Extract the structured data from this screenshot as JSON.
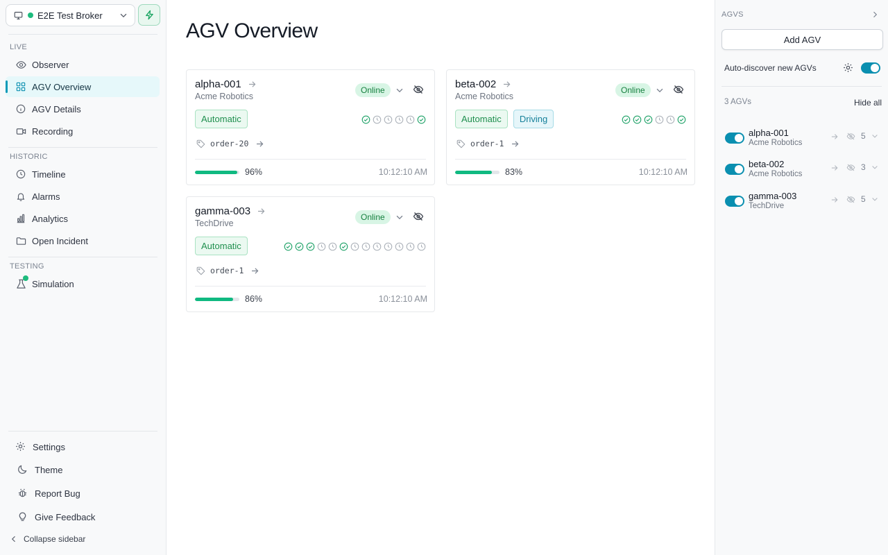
{
  "broker": {
    "name": "E2E Test Broker",
    "status_color": "#1dbb7d"
  },
  "sidebar": {
    "sections": {
      "live": "LIVE",
      "historic": "HISTORIC",
      "testing": "TESTING"
    },
    "live_items": [
      {
        "label": "Observer",
        "icon": "eye-icon"
      },
      {
        "label": "AGV Overview",
        "icon": "grid-icon",
        "active": true
      },
      {
        "label": "AGV Details",
        "icon": "info-icon"
      },
      {
        "label": "Recording",
        "icon": "video-icon"
      }
    ],
    "historic_items": [
      {
        "label": "Timeline",
        "icon": "clock-icon"
      },
      {
        "label": "Alarms",
        "icon": "bell-icon"
      },
      {
        "label": "Analytics",
        "icon": "bar-chart-icon"
      },
      {
        "label": "Open Incident",
        "icon": "folder-icon"
      }
    ],
    "testing_items": [
      {
        "label": "Simulation",
        "icon": "flask-icon"
      }
    ],
    "bottom": {
      "settings": "Settings",
      "theme": "Theme",
      "report_bug": "Report Bug",
      "give_feedback": "Give Feedback",
      "collapse": "Collapse sidebar"
    }
  },
  "main": {
    "title": "AGV Overview",
    "cards": [
      {
        "name": "alpha-001",
        "manufacturer": "Acme Robotics",
        "status": "Online",
        "tags": [
          "Automatic"
        ],
        "steps": [
          "done",
          "pending",
          "pending",
          "pending",
          "pending",
          "done"
        ],
        "order": "order-20",
        "progress_pct": 96,
        "progress": "96%",
        "time": "10:12:10 AM"
      },
      {
        "name": "beta-002",
        "manufacturer": "Acme Robotics",
        "status": "Online",
        "tags": [
          "Automatic",
          "Driving"
        ],
        "steps": [
          "done",
          "done",
          "done",
          "pending",
          "pending",
          "done"
        ],
        "order": "order-1",
        "progress_pct": 83,
        "progress": "83%",
        "time": "10:12:10 AM"
      },
      {
        "name": "gamma-003",
        "manufacturer": "TechDrive",
        "status": "Online",
        "tags": [
          "Automatic"
        ],
        "steps": [
          "done",
          "done",
          "done",
          "pending",
          "pending",
          "done",
          "pending",
          "pending",
          "pending",
          "pending",
          "pending",
          "pending",
          "pending"
        ],
        "order": "order-1",
        "progress_pct": 86,
        "progress": "86%",
        "time": "10:12:10 AM"
      }
    ]
  },
  "agv_panel": {
    "title": "AGVS",
    "add_button": "Add AGV",
    "auto_discover": "Auto-discover new AGVs",
    "count": "3 AGVs",
    "hide_all": "Hide all",
    "items": [
      {
        "name": "alpha-001",
        "manufacturer": "Acme Robotics",
        "count": "5"
      },
      {
        "name": "beta-002",
        "manufacturer": "Acme Robotics",
        "count": "3"
      },
      {
        "name": "gamma-003",
        "manufacturer": "TechDrive",
        "count": "5"
      }
    ]
  },
  "colors": {
    "accent": "#0a9ab8",
    "online_bg": "#d8f5e5",
    "success": "#10b981"
  }
}
